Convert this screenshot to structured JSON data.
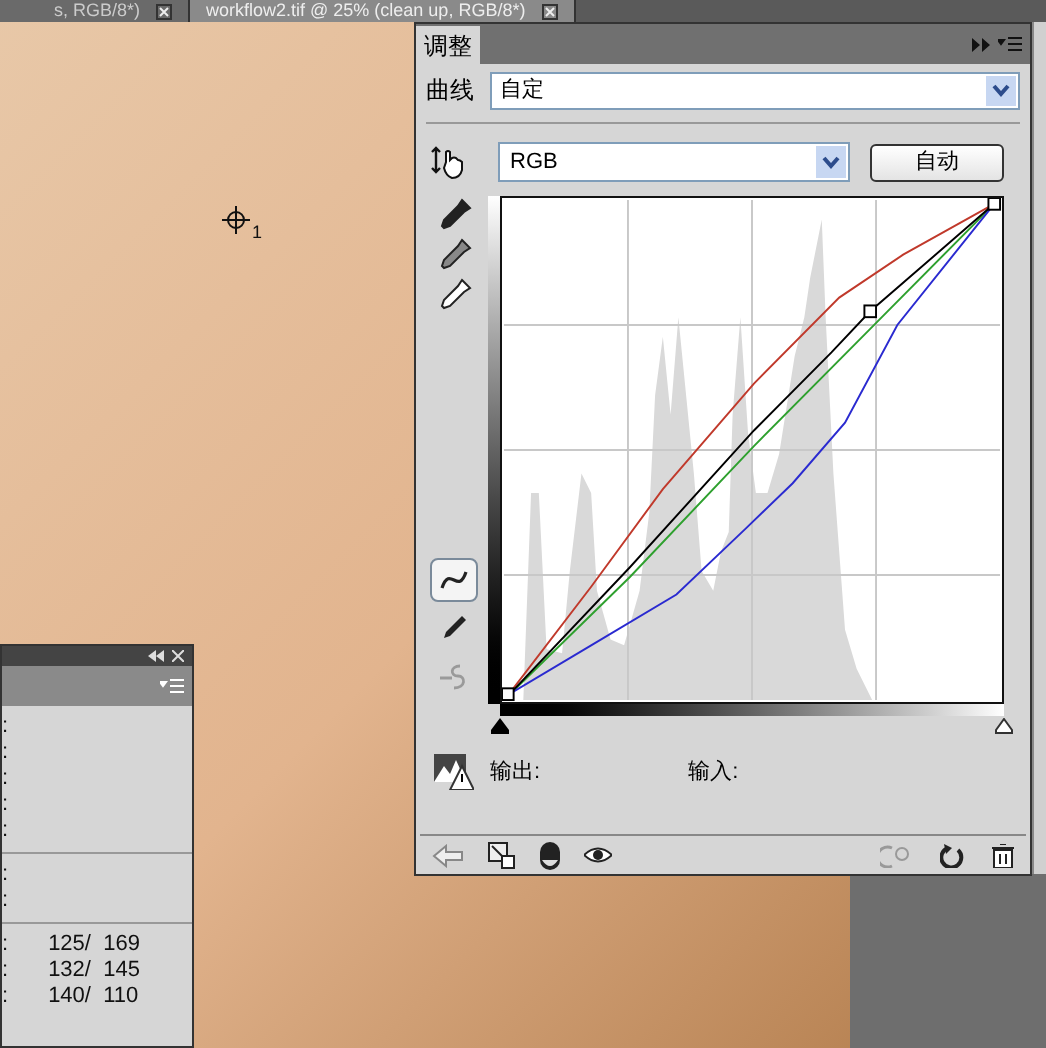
{
  "document_tabs": [
    {
      "title": "s, RGB/8*)",
      "selected": false
    },
    {
      "title": "workflow2.tif @ 25% (clean up, RGB/8*)",
      "selected": true
    }
  ],
  "color_sampler": {
    "label": "1"
  },
  "adjustments_panel": {
    "tab_title": "调整",
    "preset_label": "曲线",
    "preset_value": "自定",
    "channel_value": "RGB",
    "auto_button": "自动",
    "tools": [
      {
        "kind": "curve",
        "selected": true,
        "disabled": false
      },
      {
        "kind": "pencil",
        "selected": false,
        "disabled": false
      },
      {
        "kind": "smooth",
        "selected": false,
        "disabled": true
      }
    ],
    "shadow_slider": {
      "level": 0
    },
    "highlight_slider": {
      "level": 1
    },
    "output_label": "输出:",
    "input_label": "输入:"
  },
  "info_panel": {
    "sections": [
      {
        "rows": [
          {
            "label": ":"
          },
          {
            "label": ":"
          },
          {
            "label": ":"
          },
          {
            "label": ":"
          },
          {
            "label": ":"
          }
        ]
      },
      {
        "rows": [
          {
            "label": ":"
          },
          {
            "label": ":"
          }
        ]
      },
      {
        "rows": [
          {
            "label": ":",
            "value": "125/  169"
          },
          {
            "label": ":",
            "value": "132/  145"
          },
          {
            "label": ":",
            "value": "140/  110"
          }
        ]
      }
    ]
  }
}
